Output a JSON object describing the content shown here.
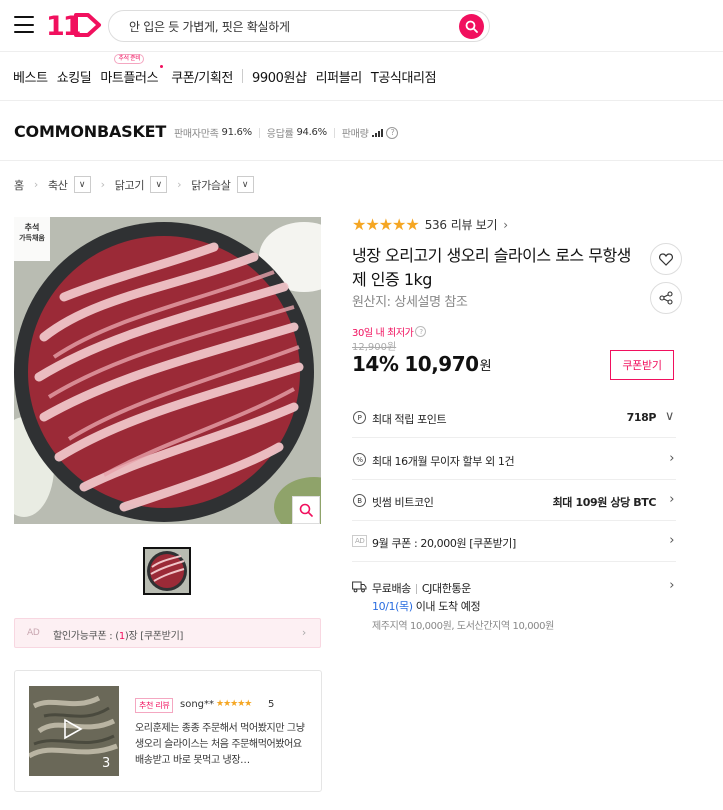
{
  "header": {
    "search_placeholder": "안 입은 듯 가볍게, 핏은 확실하게"
  },
  "nav": {
    "items": [
      "베스트",
      "쇼킹딜",
      "마트플러스",
      "쿠폰/기획전",
      "9900원샵",
      "리퍼블리",
      "T공식대리점"
    ],
    "mart_badge": "추석 준비"
  },
  "store": {
    "name": "COMMONBASKET",
    "seller_label": "판매자만족",
    "seller_value": "91.6%",
    "response_label": "응답률",
    "response_value": "94.6%",
    "sales_label": "판매량"
  },
  "breadcrumb": {
    "home": "홈",
    "cat1": "축산",
    "cat2": "닭고기",
    "cat3": "닭가슴살"
  },
  "image": {
    "badge_line1": "추석",
    "badge_line2": "가득채움"
  },
  "coupon_bar": {
    "ad": "AD",
    "text_before": "할인가능쿠폰 : (",
    "count": "1",
    "text_after": ")장 [쿠폰받기]"
  },
  "review_card": {
    "count": "3",
    "tag": "추천 리뷰",
    "user": "song**",
    "stars": "★★★★★",
    "score": "5",
    "text": "오리훈제는 종종 주문해서 먹어봤지만 그냥 생오리 슬라이스는 처음 주문해먹어봤어요 배송받고 바로 못먹고 냉장…"
  },
  "product": {
    "stars": "★★★★★",
    "review_count": "536",
    "review_link": "리뷰 보기",
    "title": "냉장 오리고기 생오리 슬라이스 로스 무항생제 인증 1kg",
    "origin": "원산지: 상세설명 참조",
    "lowest_label": "30일 내 최저가",
    "original_price": "12,900원",
    "discount": "14%",
    "price": "10,970",
    "currency": "원",
    "coupon_button": "쿠폰받기"
  },
  "info_rows": {
    "points_label": "최대 적립 포인트",
    "points_value": "718P",
    "installment_label": "최대 16개월 무이자 할부 외 1건",
    "bitcoin_label": "빗썸 비트코인",
    "bitcoin_value": "최대 109원 상당 BTC",
    "coupon_ad": "AD",
    "coupon_label": "9월 쿠폰 : 20,000원 [쿠폰받기]"
  },
  "shipping": {
    "free": "무료배송",
    "carrier": "CJ대한통운",
    "eta_date": "10/1(목)",
    "eta_rest": " 이내 도착 예정",
    "extra": "제주지역 10,000원, 도서산간지역 10,000원"
  },
  "colors": {
    "accent": "#f1105e",
    "star": "#f5a623",
    "link_blue": "#2a6de0"
  }
}
